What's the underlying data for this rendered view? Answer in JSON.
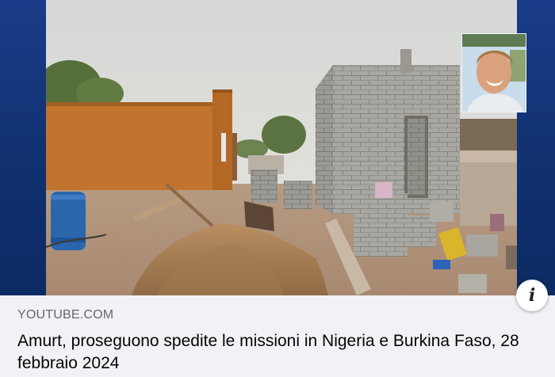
{
  "link_preview": {
    "domain": "YOUTUBE.COM",
    "title": "Amurt, proseguono spedite le missioni in Nigeria e Burkina Faso, 28 febbraio 2024"
  },
  "thumbnail": {
    "pip_icon": "presenter-portrait"
  },
  "info_button": {
    "glyph": "i",
    "icon": "info-icon"
  },
  "colors": {
    "frame_blue": "#1a3c88",
    "meta_background": "#f0f2f5",
    "domain_text": "#65676b",
    "title_text": "#050505"
  }
}
